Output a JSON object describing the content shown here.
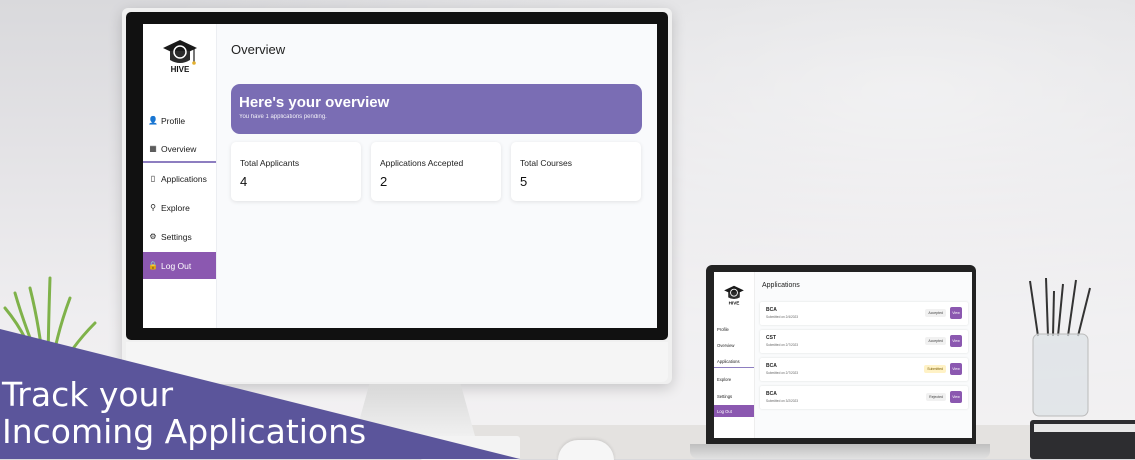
{
  "main_app": {
    "nav": [
      {
        "label": "Profile",
        "icon": "user-icon"
      },
      {
        "label": "Overview",
        "icon": "dashboard-icon"
      },
      {
        "label": "Applications",
        "icon": "document-icon"
      },
      {
        "label": "Explore",
        "icon": "search-icon"
      },
      {
        "label": "Settings",
        "icon": "gear-icon"
      },
      {
        "label": "Log Out",
        "icon": "lock-icon"
      }
    ],
    "page_title": "Overview",
    "banner": {
      "heading": "Here's your overview",
      "subtext": "You have 1 applications pending."
    },
    "stats": [
      {
        "label": "Total Applicants",
        "value": "4"
      },
      {
        "label": "Applications Accepted",
        "value": "2"
      },
      {
        "label": "Total Courses",
        "value": "5"
      }
    ]
  },
  "laptop_app": {
    "nav": [
      {
        "label": "Profile"
      },
      {
        "label": "Overview"
      },
      {
        "label": "Applications"
      },
      {
        "label": "Explore"
      },
      {
        "label": "Settings"
      },
      {
        "label": "Log Out"
      }
    ],
    "page_title": "Applications",
    "rows": [
      {
        "course": "BCA",
        "submitted": "Submitted on 2/4/2023",
        "status": "Accepted",
        "action": "View"
      },
      {
        "course": "CST",
        "submitted": "Submitted on 2/7/2023",
        "status": "Accepted",
        "action": "View"
      },
      {
        "course": "BCA",
        "submitted": "Submitted on 2/7/2023",
        "status": "Submitted",
        "action": "View"
      },
      {
        "course": "BCA",
        "submitted": "Submitted on 3/2/2023",
        "status": "Rejected",
        "action": "View"
      }
    ]
  },
  "caption": {
    "line1": "Track your",
    "line2": "Incoming Applications"
  },
  "colors": {
    "accent": "#7a6db4",
    "logout": "#8b58b0",
    "caption_bg": "#5b559b"
  }
}
